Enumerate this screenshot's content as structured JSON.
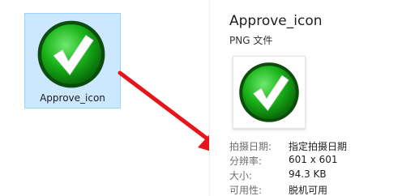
{
  "file": {
    "name": "Approve_icon",
    "icon": "green-checkmark-icon",
    "selected_bg": "#cce8ff"
  },
  "details": {
    "title": "Approve_icon",
    "subtitle": "PNG 文件",
    "properties": [
      {
        "label": "拍摄日期:",
        "value": "指定拍摄日期"
      },
      {
        "label": "分辨率:",
        "value": "601 x 601"
      },
      {
        "label": "大小:",
        "value": "94.3 KB"
      },
      {
        "label": "可用性:",
        "value": "脱机可用"
      }
    ]
  },
  "annotation": {
    "icon": "red-arrow-icon",
    "color": "#e8141c"
  },
  "colors": {
    "check_green": "#1aa61a",
    "check_dark": "#0b5e0b"
  }
}
